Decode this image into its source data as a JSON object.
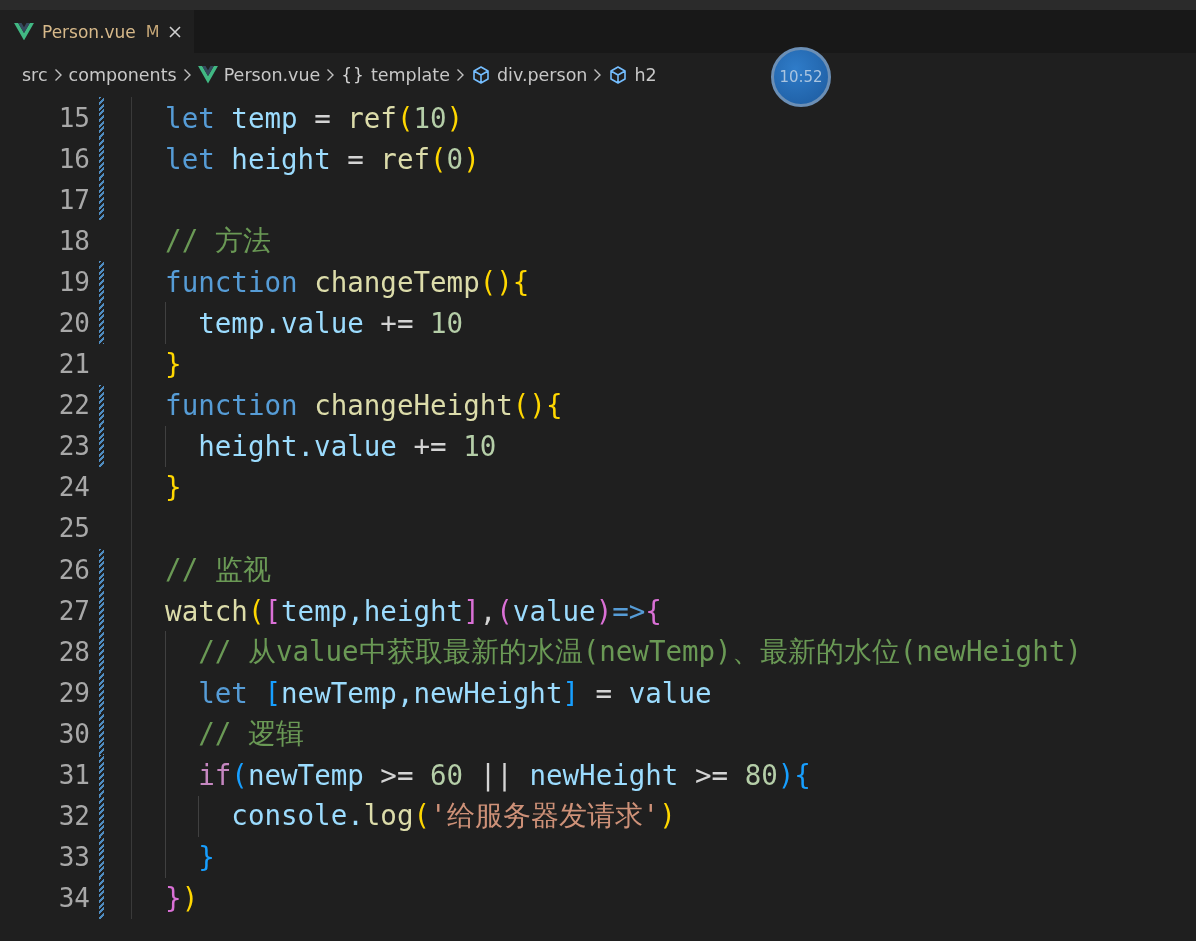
{
  "tabs": [
    {
      "label": "Person.vue",
      "badge": "M",
      "selected": true
    }
  ],
  "breadcrumbs": [
    {
      "label": "src",
      "kind": "folder"
    },
    {
      "label": "components",
      "kind": "folder"
    },
    {
      "label": "Person.vue",
      "kind": "vue"
    },
    {
      "label": "template",
      "kind": "braces",
      "icon": "{}"
    },
    {
      "label": "div.person",
      "kind": "element"
    },
    {
      "label": "h2",
      "kind": "element"
    }
  ],
  "timer": "10:52",
  "lines": [
    {
      "number": "15",
      "changed": true,
      "tokens": [
        {
          "kind": "keyword",
          "text": "let "
        },
        {
          "kind": "variable",
          "text": "temp"
        },
        {
          "kind": "plain",
          "text": " = "
        },
        {
          "kind": "function",
          "text": "ref"
        },
        {
          "kind": "bracket1",
          "text": "("
        },
        {
          "kind": "number",
          "text": "10"
        },
        {
          "kind": "bracket1",
          "text": ")"
        }
      ]
    },
    {
      "number": "16",
      "changed": true,
      "tokens": [
        {
          "kind": "keyword",
          "text": "let "
        },
        {
          "kind": "variable",
          "text": "height"
        },
        {
          "kind": "plain",
          "text": " = "
        },
        {
          "kind": "function",
          "text": "ref"
        },
        {
          "kind": "bracket1",
          "text": "("
        },
        {
          "kind": "number",
          "text": "0"
        },
        {
          "kind": "bracket1",
          "text": ")"
        }
      ]
    },
    {
      "number": "17",
      "changed": true
    },
    {
      "number": "18",
      "changed": false,
      "tokens": [
        {
          "kind": "comment",
          "text": "// 方法"
        }
      ]
    },
    {
      "number": "19",
      "changed": true,
      "tokens": [
        {
          "kind": "keyword",
          "text": "function "
        },
        {
          "kind": "function",
          "text": "changeTemp"
        },
        {
          "kind": "bracket1",
          "text": "(){"
        }
      ],
      "children": [
        {
          "number": "20",
          "changed": true,
          "tokens": [
            {
              "kind": "variable",
              "text": "temp.value"
            },
            {
              "kind": "plain",
              "text": " += "
            },
            {
              "kind": "number",
              "text": "10"
            }
          ]
        }
      ]
    },
    {
      "number": "21",
      "changed": false,
      "tokens": [
        {
          "kind": "bracket1",
          "text": "}"
        }
      ]
    },
    {
      "number": "22",
      "changed": true,
      "tokens": [
        {
          "kind": "keyword",
          "text": "function "
        },
        {
          "kind": "function",
          "text": "changeHeight"
        },
        {
          "kind": "bracket1",
          "text": "(){"
        }
      ],
      "children": [
        {
          "number": "23",
          "changed": true,
          "tokens": [
            {
              "kind": "variable",
              "text": "height.value"
            },
            {
              "kind": "plain",
              "text": " += "
            },
            {
              "kind": "number",
              "text": "10"
            }
          ]
        }
      ]
    },
    {
      "number": "24",
      "changed": false,
      "tokens": [
        {
          "kind": "bracket1",
          "text": "}"
        }
      ]
    },
    {
      "number": "25",
      "changed": false
    },
    {
      "number": "26",
      "changed": true,
      "tokens": [
        {
          "kind": "comment",
          "text": "// 监视"
        }
      ]
    },
    {
      "number": "27",
      "changed": true,
      "tokens": [
        {
          "kind": "function",
          "text": "watch"
        },
        {
          "kind": "bracket1",
          "text": "("
        },
        {
          "kind": "bracket2",
          "text": "["
        },
        {
          "kind": "variable",
          "text": "temp,height"
        },
        {
          "kind": "bracket2",
          "text": "]"
        },
        {
          "kind": "plain",
          "text": ","
        },
        {
          "kind": "bracket2",
          "text": "("
        },
        {
          "kind": "variable",
          "text": "value"
        },
        {
          "kind": "bracket2",
          "text": ")"
        },
        {
          "kind": "keyword",
          "text": "=>"
        },
        {
          "kind": "bracket2",
          "text": "{"
        }
      ],
      "children": [
        {
          "number": "28",
          "changed": true,
          "tokens": [
            {
              "kind": "comment",
              "text": "// 从value中获取最新的水温(newTemp)、最新的水位(newHeight)"
            }
          ]
        },
        {
          "number": "29",
          "changed": true,
          "tokens": [
            {
              "kind": "keyword",
              "text": "let "
            },
            {
              "kind": "bracket3",
              "text": "["
            },
            {
              "kind": "variable",
              "text": "newTemp,newHeight"
            },
            {
              "kind": "bracket3",
              "text": "]"
            },
            {
              "kind": "plain",
              "text": " = "
            },
            {
              "kind": "variable",
              "text": "value"
            }
          ]
        },
        {
          "number": "30",
          "changed": true,
          "tokens": [
            {
              "kind": "comment",
              "text": "// 逻辑"
            }
          ]
        },
        {
          "number": "31",
          "changed": true,
          "tokens": [
            {
              "kind": "control",
              "text": "if"
            },
            {
              "kind": "bracket3",
              "text": "("
            },
            {
              "kind": "variable",
              "text": "newTemp"
            },
            {
              "kind": "plain",
              "text": " >= "
            },
            {
              "kind": "number",
              "text": "60"
            },
            {
              "kind": "plain",
              "text": " || "
            },
            {
              "kind": "variable",
              "text": "newHeight"
            },
            {
              "kind": "plain",
              "text": " >= "
            },
            {
              "kind": "number",
              "text": "80"
            },
            {
              "kind": "bracket3",
              "text": "){"
            }
          ],
          "children": [
            {
              "number": "32",
              "changed": true,
              "tokens": [
                {
                  "kind": "variable",
                  "text": "console."
                },
                {
                  "kind": "function",
                  "text": "log"
                },
                {
                  "kind": "bracket1",
                  "text": "("
                },
                {
                  "kind": "string",
                  "text": "'给服务器发请求'"
                },
                {
                  "kind": "bracket1",
                  "text": ")"
                }
              ]
            }
          ]
        },
        {
          "number": "33",
          "changed": true,
          "tokens": [
            {
              "kind": "bracket3",
              "text": "}"
            }
          ]
        }
      ]
    },
    {
      "number": "34",
      "changed": true,
      "tokens": [
        {
          "kind": "bracket2",
          "text": "}"
        },
        {
          "kind": "bracket1",
          "text": ")"
        }
      ]
    }
  ]
}
